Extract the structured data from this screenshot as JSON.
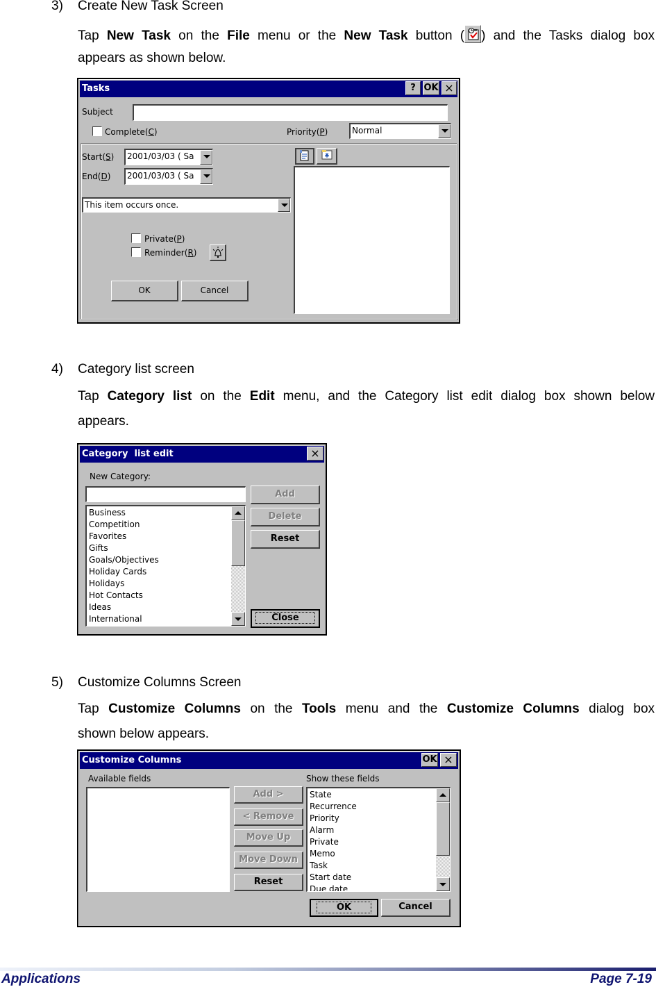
{
  "sections": [
    {
      "number": "3)",
      "title": "Create New Task Screen",
      "line1": [
        "Tap ",
        "New Task",
        " on the ",
        "File",
        " menu or the ",
        "New Task",
        " button (",
        ") and the Tasks dialog box"
      ],
      "line2": "appears as shown below.",
      "icon": "new-task-icon"
    },
    {
      "number": "4)",
      "title": "Category list screen",
      "line1": [
        "Tap ",
        "Category list",
        " on the ",
        "Edit",
        " menu, and the Category list edit dialog box shown below"
      ],
      "line2": "appears."
    },
    {
      "number": "5)",
      "title": "Customize Columns Screen",
      "line1": [
        "Tap ",
        "Customize Columns",
        " on the ",
        "Tools",
        " menu and the ",
        "Customize Columns",
        " dialog box"
      ],
      "line2": "shown below appears."
    }
  ],
  "tasks_dialog": {
    "title": "Tasks",
    "help_btn": "?",
    "ok_btn": "OK",
    "close_btn": "×",
    "subject_label": "Subject",
    "subject_value": "",
    "complete_label": "Complete(",
    "complete_key": "C",
    "priority_label": "Priority(",
    "priority_key": "P",
    "priority_value": "Normal",
    "start_label": "Start(",
    "start_key": "S",
    "start_value": "2001/03/03 ( Sa",
    "end_label": "End(",
    "end_key": "D",
    "end_value": "2001/03/03 ( Sa",
    "recurrence_value": "This item occurs once.",
    "private_label": "Private(",
    "private_key": "P",
    "reminder_label": "Reminder(",
    "reminder_key": "R",
    "ok_label": "OK",
    "cancel_label": "Cancel",
    "close_paren": ")"
  },
  "category_dialog": {
    "title": "Category  list edit",
    "close_btn": "×",
    "new_category_label": "New Category:",
    "new_category_value": "",
    "add_label": "Add",
    "delete_label": "Delete",
    "reset_label": "Reset",
    "close_label": "Close",
    "items": [
      "Business",
      "Competition",
      "Favorites",
      "Gifts",
      "Goals/Objectives",
      "Holiday Cards",
      "Holidays",
      "Hot Contacts",
      "Ideas",
      "International"
    ]
  },
  "columns_dialog": {
    "title": "Customize Columns",
    "ok_btn": "OK",
    "close_btn": "×",
    "available_label": "Available fields",
    "show_label": "Show these fields",
    "add_label": "Add >",
    "remove_label": "< Remove",
    "move_up_label": "Move Up",
    "move_down_label": "Move Down",
    "reset_label": "Reset",
    "ok_label": "OK",
    "cancel_label": "Cancel",
    "show_items": [
      "State",
      "Recurrence",
      "Priority",
      "Alarm",
      "Private",
      "Memo",
      "Task",
      "Start date",
      "Due date"
    ]
  },
  "footer": {
    "left": "Applications",
    "right": "Page 7-19"
  }
}
